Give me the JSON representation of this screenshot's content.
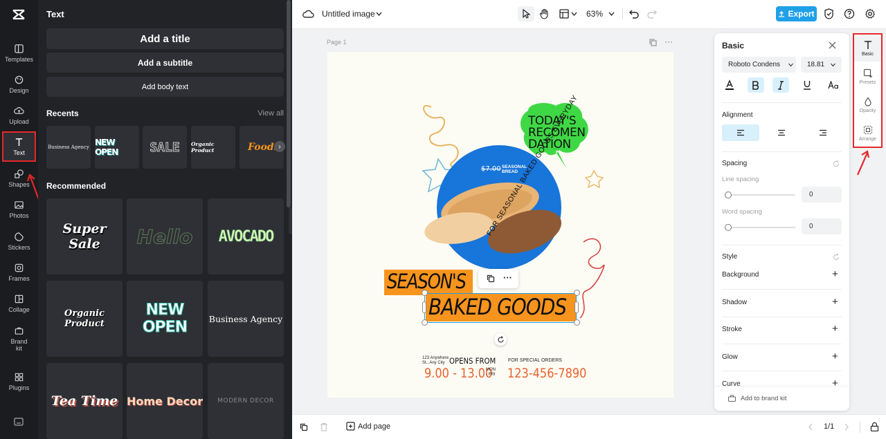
{
  "app": {
    "name": "CapCut"
  },
  "rail": {
    "items": [
      {
        "label": "Templates",
        "icon": "templates-icon"
      },
      {
        "label": "Design",
        "icon": "design-icon"
      },
      {
        "label": "Upload",
        "icon": "upload-icon"
      },
      {
        "label": "Text",
        "icon": "text-icon"
      },
      {
        "label": "Shapes",
        "icon": "shapes-icon"
      },
      {
        "label": "Photos",
        "icon": "photos-icon"
      },
      {
        "label": "Stickers",
        "icon": "stickers-icon"
      },
      {
        "label": "Frames",
        "icon": "frames-icon"
      },
      {
        "label": "Collage",
        "icon": "collage-icon"
      },
      {
        "label": "Brand kit",
        "icon": "brand-kit-icon"
      },
      {
        "label": "Plugins",
        "icon": "plugins-icon"
      }
    ],
    "active": "Text"
  },
  "panel": {
    "title": "Text",
    "add_title": "Add a title",
    "add_subtitle": "Add a subtitle",
    "add_body": "Add body text",
    "recents_label": "Recents",
    "view_all": "View all",
    "recents": [
      "Business Agency",
      "NEW OPEN",
      "SALE",
      "Organic Product",
      "Foodie"
    ],
    "recommended_label": "Recommended",
    "recommended": [
      "Super Sale",
      "Hello",
      "AVOCADO",
      "Organic Product",
      "NEW OPEN",
      "Business Agency",
      "Tea Time",
      "Home Decor",
      "MODERN DECOR"
    ]
  },
  "topbar": {
    "doc_title": "Untitled image",
    "zoom": "63%",
    "export_label": "Export"
  },
  "canvas": {
    "page_label": "Page 1",
    "poster": {
      "bubble_text": [
        "TODAY'S",
        "RECOMEN",
        "DATION"
      ],
      "price": "$7.00",
      "price_tag": [
        "SEASONAL",
        "BREAD"
      ],
      "circle_text": "FOR SEASONAL BAKED GOODS EVERYDAY",
      "headline1": "SEASON'S",
      "headline2": "BAKED GOODS",
      "address": [
        "123 Anywhere",
        "St., Any City"
      ],
      "opens_label": "OPENS FROM",
      "hours": "9.00 - 13.00",
      "days": [
        "MON",
        "- FRI"
      ],
      "orders_label": "FOR SPECIAL ORDERS",
      "phone": "123-456-7890"
    }
  },
  "bottombar": {
    "add_page": "Add page",
    "page_count": "1/1"
  },
  "props": {
    "title": "Basic",
    "font": "Roboto Condens",
    "font_size": "18.81",
    "alignment_label": "Alignment",
    "spacing_label": "Spacing",
    "line_spacing_label": "Line spacing",
    "line_spacing_value": "0",
    "word_spacing_label": "Word spacing",
    "word_spacing_value": "0",
    "style_label": "Style",
    "style_items": [
      "Background",
      "Shadow",
      "Stroke",
      "Glow",
      "Curve"
    ],
    "brand_kit": "Add to brand kit"
  },
  "rightrail": {
    "items": [
      "Basic",
      "Presets",
      "Opacity",
      "Arrange"
    ]
  },
  "colors": {
    "accent": "#1fa0e8",
    "orange": "#f7941d",
    "blue": "#1875d9",
    "green": "#3fd845",
    "red_annotation": "#e5282a"
  }
}
